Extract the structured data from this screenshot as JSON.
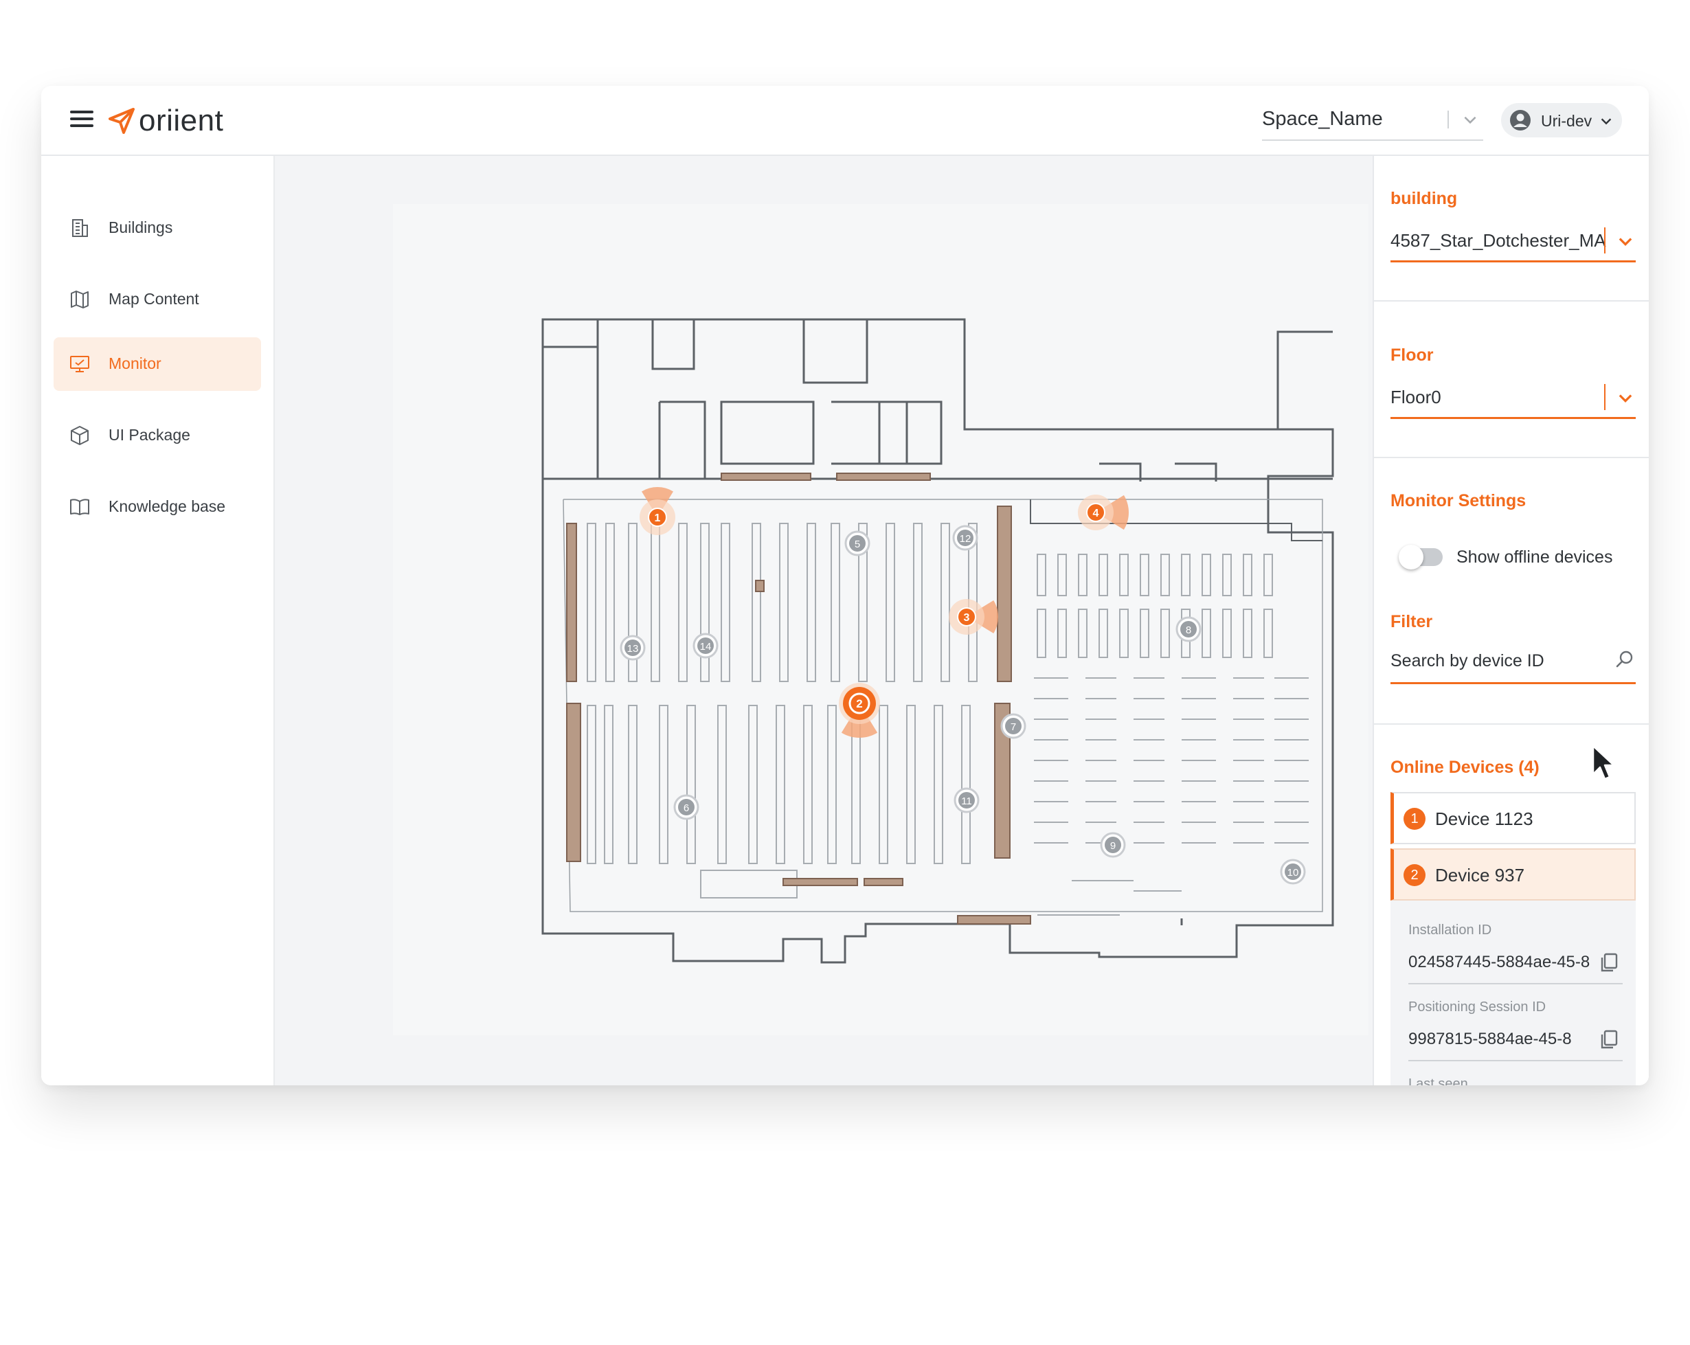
{
  "header": {
    "brand": "oriient",
    "space_select": {
      "value": "Space_Name"
    },
    "user": {
      "name": "Uri-dev"
    }
  },
  "sidebar": {
    "items": [
      {
        "label": "Buildings",
        "icon": "building-icon",
        "active": false
      },
      {
        "label": "Map Content",
        "icon": "map-icon",
        "active": false
      },
      {
        "label": "Monitor",
        "icon": "monitor-icon",
        "active": true
      },
      {
        "label": "UI Package",
        "icon": "package-icon",
        "active": false
      },
      {
        "label": "Knowledge base",
        "icon": "book-icon",
        "active": false
      }
    ]
  },
  "map": {
    "active_markers": [
      "1",
      "2",
      "3",
      "4"
    ],
    "inactive_markers": [
      "5",
      "6",
      "7",
      "8",
      "9",
      "10",
      "11",
      "12",
      "13",
      "14"
    ],
    "selected_marker": "2"
  },
  "panel": {
    "building": {
      "title": "building",
      "value": "4587_Star_Dotchester_MA"
    },
    "floor": {
      "title": "Floor",
      "value": "Floor0"
    },
    "monitor_settings": {
      "title": "Monitor Settings",
      "toggle_label": "Show offline devices",
      "toggle_on": false
    },
    "filter": {
      "title": "Filter",
      "placeholder": "Search by device ID"
    },
    "online_devices": {
      "title": "Online Devices (4)",
      "items": [
        {
          "badge": "1",
          "name": "Device 1123",
          "selected": false
        },
        {
          "badge": "2",
          "name": "Device 937",
          "selected": true
        }
      ]
    },
    "details": {
      "installation_id_label": "Installation ID",
      "installation_id": "024587445-5884ae-45-8",
      "positioning_session_label": "Positioning Session ID",
      "positioning_session_id": "9987815-5884ae-45-8",
      "last_seen_label": "Last seen"
    }
  },
  "colors": {
    "accent": "#f26b1d",
    "accent_light": "#fdeee3",
    "shelf": "#b79a86",
    "wall": "#5c6166"
  }
}
